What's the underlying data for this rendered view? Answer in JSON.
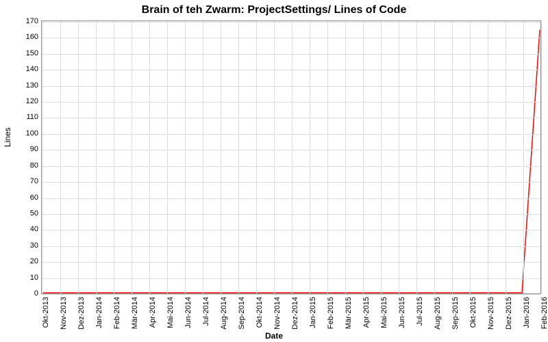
{
  "chart_data": {
    "type": "line",
    "title": "Brain of teh Zwarm: ProjectSettings/ Lines of Code",
    "xlabel": "Date",
    "ylabel": "Lines",
    "ylim": [
      0,
      170
    ],
    "y_ticks": [
      0,
      10,
      20,
      30,
      40,
      50,
      60,
      70,
      80,
      90,
      100,
      110,
      120,
      130,
      140,
      150,
      160,
      170
    ],
    "x_categories": [
      "Okt-2013",
      "Nov-2013",
      "Dez-2013",
      "Jan-2014",
      "Feb-2014",
      "Mär-2014",
      "Apr-2014",
      "Mai-2014",
      "Jun-2014",
      "Jul-2014",
      "Aug-2014",
      "Sep-2014",
      "Okt-2014",
      "Nov-2014",
      "Dez-2014",
      "Jan-2015",
      "Feb-2015",
      "Mär-2015",
      "Apr-2015",
      "Mai-2015",
      "Jun-2015",
      "Jul-2015",
      "Aug-2015",
      "Sep-2015",
      "Okt-2015",
      "Nov-2015",
      "Dez-2015",
      "Jan-2016",
      "Feb-2016"
    ],
    "series": [
      {
        "name": "Lines of Code",
        "color": "#ff0000",
        "points": [
          {
            "x": "Okt-2013",
            "y": 0
          },
          {
            "x": "Nov-2013",
            "y": 0
          },
          {
            "x": "Dez-2013",
            "y": 0
          },
          {
            "x": "Jan-2014",
            "y": 0
          },
          {
            "x": "Feb-2014",
            "y": 0
          },
          {
            "x": "Mär-2014",
            "y": 0
          },
          {
            "x": "Apr-2014",
            "y": 0
          },
          {
            "x": "Mai-2014",
            "y": 0
          },
          {
            "x": "Jun-2014",
            "y": 0
          },
          {
            "x": "Jul-2014",
            "y": 0
          },
          {
            "x": "Aug-2014",
            "y": 0
          },
          {
            "x": "Sep-2014",
            "y": 0
          },
          {
            "x": "Okt-2014",
            "y": 0
          },
          {
            "x": "Nov-2014",
            "y": 0
          },
          {
            "x": "Dez-2014",
            "y": 0
          },
          {
            "x": "Jan-2015",
            "y": 0
          },
          {
            "x": "Feb-2015",
            "y": 0
          },
          {
            "x": "Mär-2015",
            "y": 0
          },
          {
            "x": "Apr-2015",
            "y": 0
          },
          {
            "x": "Mai-2015",
            "y": 0
          },
          {
            "x": "Jun-2015",
            "y": 0
          },
          {
            "x": "Jul-2015",
            "y": 0
          },
          {
            "x": "Aug-2015",
            "y": 0
          },
          {
            "x": "Sep-2015",
            "y": 0
          },
          {
            "x": "Okt-2015",
            "y": 0
          },
          {
            "x": "Nov-2015",
            "y": 0
          },
          {
            "x": "Dez-2015",
            "y": 0
          },
          {
            "x": "Jan-2016",
            "y": 0
          },
          {
            "x": "Feb-2016",
            "y": 165
          }
        ]
      }
    ]
  }
}
